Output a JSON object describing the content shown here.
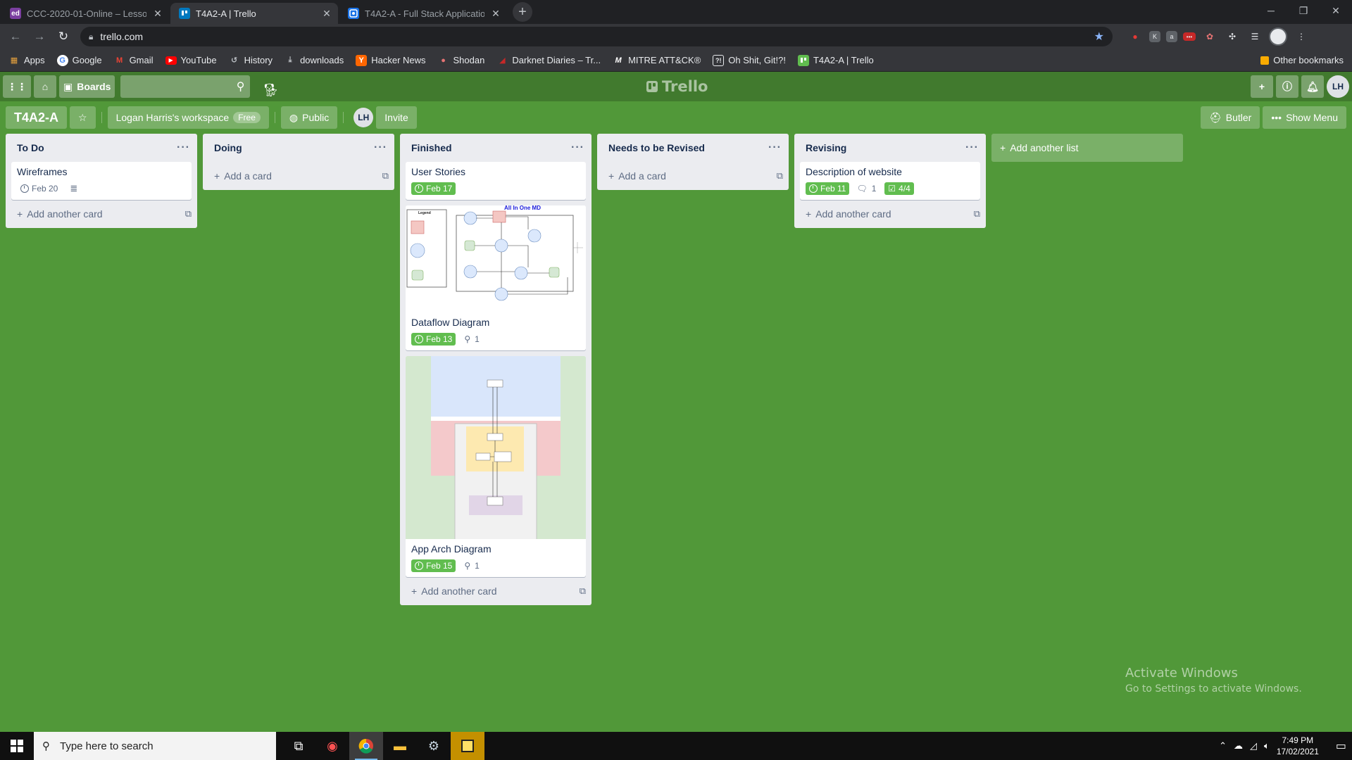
{
  "browser": {
    "tabs": [
      {
        "title": "CCC-2020-01-Online – Lessons",
        "icon": "ed-icon",
        "icon_text": "ed",
        "icon_color": "#7b3fa0"
      },
      {
        "title": "T4A2-A | Trello",
        "icon": "trello-icon",
        "icon_text": "",
        "icon_color": "#0079bf"
      },
      {
        "title": "T4A2-A - Full Stack Application -",
        "icon": "draw-io-icon",
        "icon_text": "",
        "icon_color": "#1a73e8"
      }
    ],
    "url": "trello.com",
    "bookmarks": [
      {
        "label": "Apps",
        "icon": "apps-grid-icon"
      },
      {
        "label": "Google",
        "icon": "google-icon"
      },
      {
        "label": "Gmail",
        "icon": "gmail-icon"
      },
      {
        "label": "YouTube",
        "icon": "youtube-icon"
      },
      {
        "label": "History",
        "icon": "history-icon"
      },
      {
        "label": "downloads",
        "icon": "download-icon"
      },
      {
        "label": "Hacker News",
        "icon": "hacker-news-icon"
      },
      {
        "label": "Shodan",
        "icon": "shodan-icon"
      },
      {
        "label": "Darknet Diaries – Tr...",
        "icon": "darknet-diaries-icon"
      },
      {
        "label": "MITRE ATT&CK®",
        "icon": "mitre-icon"
      },
      {
        "label": "Oh Shit, Git!?!",
        "icon": "oh-shit-git-icon"
      },
      {
        "label": "T4A2-A | Trello",
        "icon": "trello-icon"
      }
    ],
    "other_bookmarks": "Other bookmarks"
  },
  "trello_header": {
    "boards_label": "Boards",
    "logo_text": "Trello",
    "user_initials": "LH"
  },
  "board": {
    "title": "T4A2-A",
    "workspace": "Logan Harris's workspace",
    "plan": "Free",
    "visibility": "Public",
    "member_initials": "LH",
    "invite_label": "Invite",
    "butler_label": "Butler",
    "menu_label": "Show Menu",
    "add_list_label": "Add another list"
  },
  "lists": [
    {
      "title": "To Do",
      "cards": [
        {
          "title": "Wireframes",
          "due": "Feb 20",
          "due_done": false,
          "has_description": true
        }
      ],
      "add_label": "Add another card"
    },
    {
      "title": "Doing",
      "cards": [],
      "add_label": "Add a card"
    },
    {
      "title": "Finished",
      "cards": [
        {
          "title": "User Stories",
          "due": "Feb 17",
          "due_done": true
        },
        {
          "title": "Dataflow Diagram",
          "due": "Feb 13",
          "due_done": true,
          "attachments": "1",
          "cover": "dataflow",
          "cover_heading": "All In One MD",
          "cover_legend": "Legend"
        },
        {
          "title": "App Arch Diagram",
          "due": "Feb 15",
          "due_done": true,
          "attachments": "1",
          "cover": "architecture"
        }
      ],
      "add_label": "Add another card"
    },
    {
      "title": "Needs to be Revised",
      "cards": [],
      "add_label": "Add a card"
    },
    {
      "title": "Revising",
      "cards": [
        {
          "title": "Description of website",
          "due": "Feb 11",
          "due_done": true,
          "comments": "1",
          "checklist": "4/4"
        }
      ],
      "add_label": "Add another card"
    }
  ],
  "watermark": {
    "line1": "Activate Windows",
    "line2": "Go to Settings to activate Windows."
  },
  "taskbar": {
    "search_placeholder": "Type here to search",
    "time": "7:49 PM",
    "date": "17/02/2021"
  },
  "colors": {
    "board_bg": "#519839",
    "header_bg": "#417a2e",
    "due_done": "#61bd4f",
    "list_bg": "#ebecf0"
  }
}
